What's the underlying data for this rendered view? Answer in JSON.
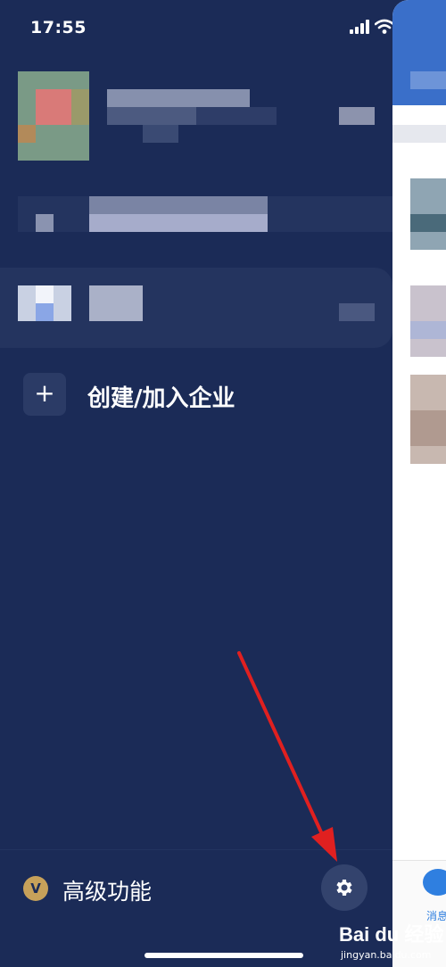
{
  "status_bar": {
    "time": "17:55"
  },
  "drawer": {
    "create_join_label": "创建/加入企业",
    "premium_label": "高级功能",
    "vip_glyph": "V"
  },
  "main_panel": {
    "tab_messages_label": "消息"
  },
  "watermark": {
    "brand": "Bai du 经验",
    "url": "jingyan.baidu.com"
  },
  "colors": {
    "drawer_bg": "#1b2b57",
    "accent_blue": "#3a6fc9",
    "vip_gold": "#c7a15a",
    "annotation_red": "#e02020"
  }
}
